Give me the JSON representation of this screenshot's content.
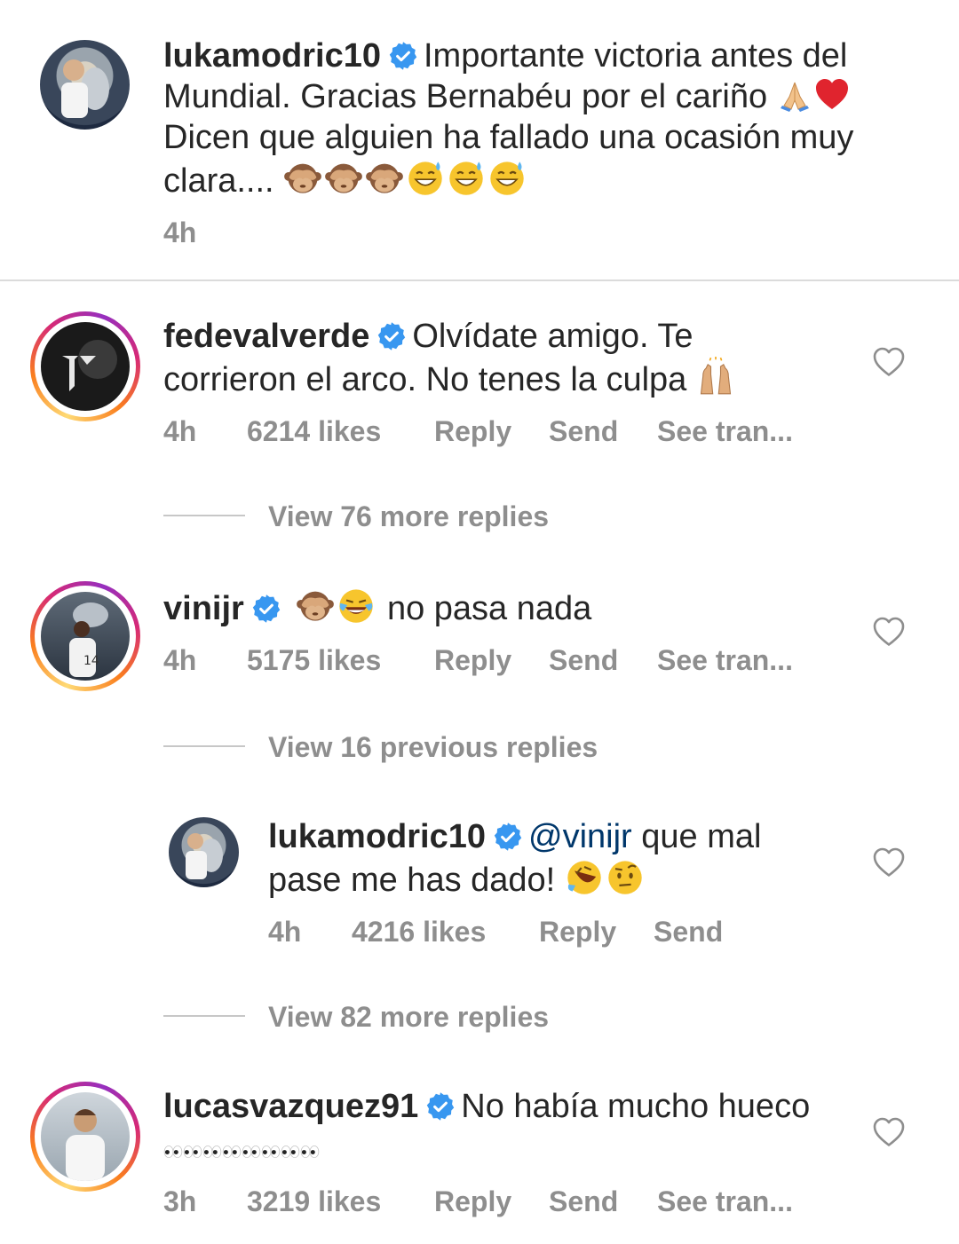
{
  "caption": {
    "username": "lukamodric10",
    "text_line1": "Importante victoria antes del",
    "text_line2": "Mundial. Gracias Bernabéu por el cariño",
    "text_line3": "Dicen que alguien ha fallado una ocasión muy",
    "text_line4": "clara....",
    "time": "4h"
  },
  "comments": [
    {
      "username": "fedevalverde",
      "text_line1": "Olvídate amigo. Te",
      "text_line2": "corrieron el arco. No tenes la culpa",
      "time": "4h",
      "likes": "6214 likes",
      "reply": "Reply",
      "send": "Send",
      "translate": "See tran...",
      "view_replies": "View 76 more replies"
    },
    {
      "username": "vinijr",
      "text": "no pasa nada",
      "time": "4h",
      "likes": "5175 likes",
      "reply": "Reply",
      "send": "Send",
      "translate": "See tran...",
      "view_previous": "View 16 previous replies",
      "reply_item": {
        "username": "lukamodric10",
        "mention": "@vinijr",
        "text_line1": "que mal",
        "text_line2": "pase me has dado!",
        "time": "4h",
        "likes": "4216 likes",
        "reply": "Reply",
        "send": "Send"
      },
      "view_replies": "View 82 more replies"
    },
    {
      "username": "lucasvazquez91",
      "text": "No había mucho hueco",
      "time": "3h",
      "likes": "3219 likes",
      "reply": "Reply",
      "send": "Send",
      "translate": "See tran..."
    }
  ],
  "colors": {
    "verified": "#3897f0",
    "meta_gray": "#8e8e8e",
    "mention": "#00376b",
    "divider": "#dbdbdb"
  },
  "icons": [
    "verified-badge-icon",
    "heart-icon",
    "see-no-evil-monkey-emoji",
    "grinning-sweat-emoji",
    "folded-hands-emoji",
    "red-heart-emoji",
    "raising-hands-emoji",
    "joy-emoji",
    "rofl-emoji",
    "raised-eyebrow-emoji",
    "eyes-emoji"
  ]
}
